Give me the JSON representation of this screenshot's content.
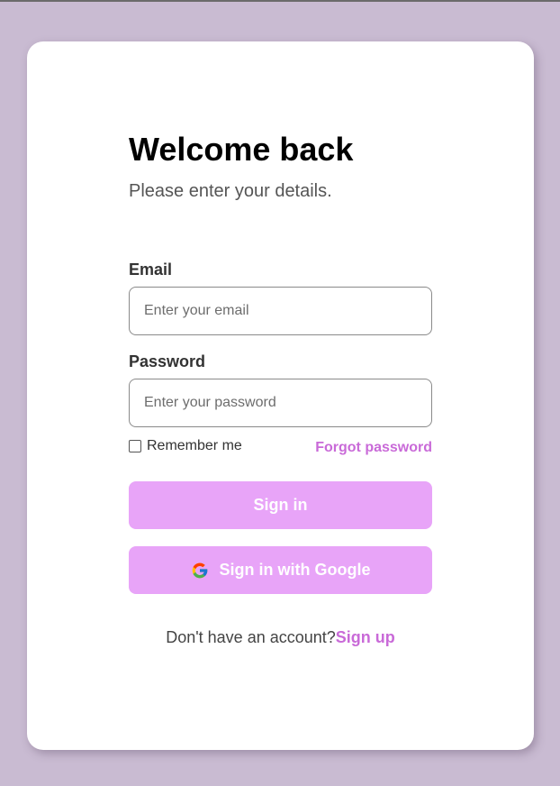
{
  "heading": {
    "title": "Welcome back",
    "subtitle": "Please enter your details."
  },
  "email": {
    "label": "Email",
    "placeholder": "Enter your email",
    "value": ""
  },
  "password": {
    "label": "Password",
    "placeholder": "Enter your password",
    "value": ""
  },
  "remember": {
    "label": "Remember me",
    "checked": false
  },
  "forgot_label": "Forgot password",
  "signin_label": "Sign in",
  "google_label": "Sign in with Google",
  "footer": {
    "prompt": "Don't have an account?",
    "signup_label": "Sign up"
  },
  "colors": {
    "background": "#c9bbd2",
    "card": "#ffffff",
    "button": "#e8a4f8",
    "accent_link": "#c96ad8"
  },
  "icons": {
    "google": "google-logo-icon",
    "checkbox": "checkbox-unchecked"
  }
}
